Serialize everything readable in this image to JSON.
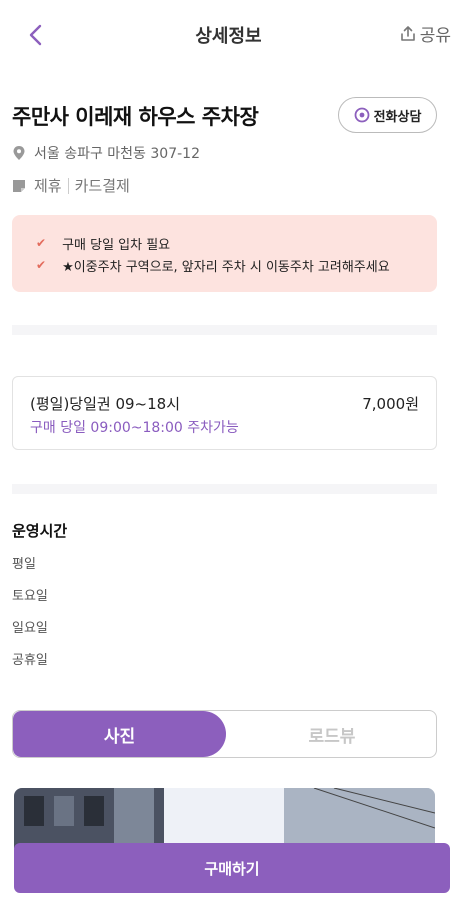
{
  "header": {
    "title": "상세정보",
    "share_label": "공유"
  },
  "lot": {
    "name": "주만사 이레재 하우스 주차장",
    "call_label": "전화상담",
    "address": "서울 송파구 마천동 307-12",
    "tags": [
      "제휴",
      "카드결제"
    ]
  },
  "notices": [
    "구매 당일 입차 필요",
    "★이중주차 구역으로, 앞자리 주차 시 이동주차 고려해주세요"
  ],
  "ticket": {
    "name": "(평일)당일권 09~18시",
    "price": "7,000원",
    "description": "구매 당일 09:00~18:00 주차가능"
  },
  "hours": {
    "title": "운영시간",
    "rows": [
      "평일",
      "토요일",
      "일요일",
      "공휴일"
    ]
  },
  "tabs": {
    "photo": "사진",
    "roadview": "로드뷰"
  },
  "buy_label": "구매하기",
  "colors": {
    "accent": "#8c5fbd",
    "notice_bg": "#fde3df",
    "check": "#e36b5c"
  }
}
